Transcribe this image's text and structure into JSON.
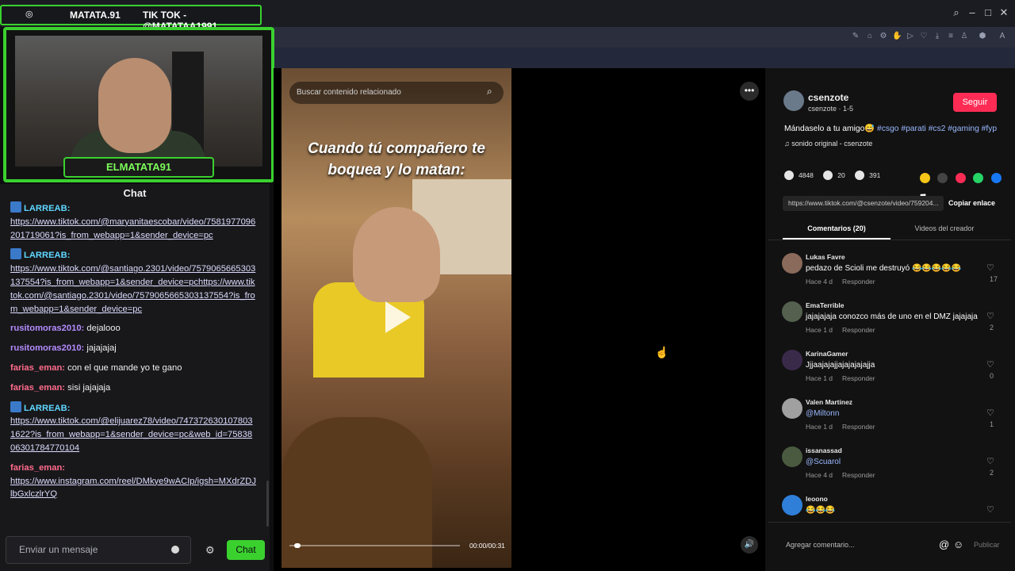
{
  "overlay": {
    "handle_left": "MATATA.91",
    "handle_right": "TIK TOK - @MATATAA1991",
    "name_plate": "ELMATATA91"
  },
  "chat": {
    "title": "Chat",
    "input_placeholder": "Enviar un mensaje",
    "send_label": "Chat",
    "messages": [
      {
        "user": "LARREAB:",
        "text": "https://www.tiktok.com/@maryanitaescobar/video/7581977096201719061?is_from_webapp=1&sender_device=pc",
        "color": "#5fd7ff",
        "link": true
      },
      {
        "user": "LARREAB:",
        "text": "https://www.tiktok.com/@santiago.2301/video/7579065665303137554?is_from_webapp=1&sender_device=pchttps://www.tiktok.com/@santiago.2301/video/7579065665303137554?is_from_webapp=1&sender_device=pc",
        "color": "#5fd7ff",
        "link": true
      },
      {
        "user": "rusitomoras2010:",
        "text": "dejalooo",
        "color": "#b48cff",
        "link": false
      },
      {
        "user": "rusitomoras2010:",
        "text": "jajajajaj",
        "color": "#b48cff",
        "link": false
      },
      {
        "user": "farias_eman:",
        "text": "con el que mande yo te gano",
        "color": "#ff6b8a",
        "link": false
      },
      {
        "user": "farias_eman:",
        "text": "sisi jajajaja",
        "color": "#ff6b8a",
        "link": false
      },
      {
        "user": "LARREAB:",
        "text": "https://www.tiktok.com/@elijuarez78/video/7473726301078031622?is_from_webapp=1&sender_device=pc&web_id=7583806301784770104",
        "color": "#5fd7ff",
        "link": true
      },
      {
        "user": "farias_eman:",
        "text": "https://www.instagram.com/reel/DMkye9wACIp/igsh=MXdrZDJlbGxlczlrYQ",
        "color": "#ff6b8a",
        "link": true
      }
    ]
  },
  "video": {
    "search_placeholder": "Buscar contenido relacionado",
    "caption": "Cuando tú compañero te boquea y lo matan:",
    "time": "00:00/00:31",
    "progress": 0.03
  },
  "post": {
    "creator": "csenzote",
    "creator_sub": "csenzote · 1-5",
    "follow_label": "Seguir",
    "description": "Mándaselo a tu amigo😅",
    "hashtags": "#csgo #parati #cs2 #gaming #fyp",
    "sound": "♫ sonido original - csenzote",
    "likes": "4848",
    "comments": "20",
    "saves": "391",
    "url": "https://www.tiktok.com/@csenzote/video/759204...",
    "copy_label": "Copiar enlace",
    "tab_comments": "Comentarios (20)",
    "tab_videos": "Videos del creador"
  },
  "comments": [
    {
      "user": "Lukas Favre",
      "text": "pedazo de Scioli me destruyó 😂😂😂😂😂",
      "age": "Hace 4 d",
      "reply": "Responder",
      "likes": "17",
      "avatar": "#8a6a5a"
    },
    {
      "user": "EmaTerrible",
      "text": "jajajajaja conozco más de uno en el DMZ jajajaja",
      "age": "Hace 1 d",
      "reply": "Responder",
      "likes": "2",
      "avatar": "#55604f"
    },
    {
      "user": "KarinaGamer",
      "text": "Jjjaajajajjajajajajajja",
      "age": "Hace 1 d",
      "reply": "Responder",
      "likes": "0",
      "avatar": "#3a2a4a"
    },
    {
      "user": "Valen Martinez",
      "text": "@Miltonn",
      "age": "Hace 1 d",
      "reply": "Responder",
      "likes": "1",
      "avatar": "#a0a0a0"
    },
    {
      "user": "issanassad",
      "text": "@Scuarol",
      "age": "Hace 4 d",
      "reply": "Responder",
      "likes": "2",
      "avatar": "#4a5a40"
    },
    {
      "user": "leoono",
      "text": "😂😂😂",
      "age": "",
      "reply": "",
      "likes": "",
      "avatar": "#2f7fd8"
    }
  ],
  "add_comment": {
    "placeholder": "Agregar comentario...",
    "publish": "Publicar"
  }
}
